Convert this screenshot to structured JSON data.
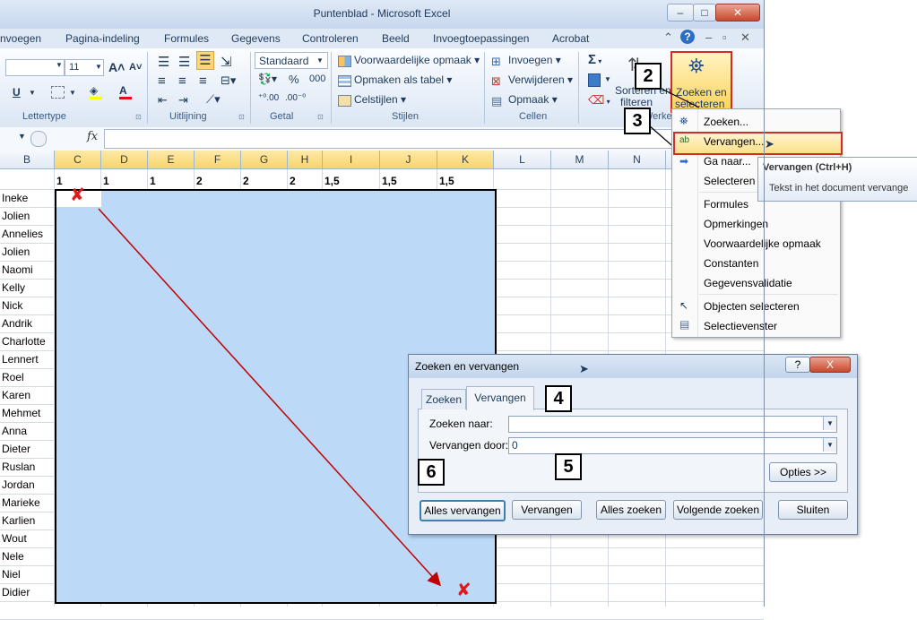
{
  "window": {
    "title": "Puntenblad  -  Microsoft Excel"
  },
  "ribbon_tabs": [
    "nvoegen",
    "Pagina-indeling",
    "Formules",
    "Gegevens",
    "Controleren",
    "Beeld",
    "Invoegtoepassingen",
    "Acrobat"
  ],
  "ribbon": {
    "font_size": "11",
    "number_format": "Standaard",
    "group_labels": {
      "font": "Lettertype",
      "alignment": "Uitlijning",
      "number": "Getal",
      "styles": "Stijlen",
      "cells": "Cellen",
      "editing": "Werke"
    },
    "styles": [
      "Voorwaardelijke opmaak",
      "Opmaken als tabel",
      "Celstijlen"
    ],
    "cells": [
      "Invoegen",
      "Verwijderen",
      "Opmaak"
    ],
    "sort_line1": "Sorteren en",
    "sort_line2": "filteren",
    "find_line1": "Zoeken en",
    "find_line2": "selecteren",
    "sigma": "Σ"
  },
  "formula_bar": {
    "fx": "fx"
  },
  "columns": [
    "B",
    "C",
    "D",
    "E",
    "F",
    "G",
    "H",
    "I",
    "J",
    "K",
    "L",
    "M",
    "N"
  ],
  "header_row": [
    "1",
    "1",
    "1",
    "2",
    "2",
    "2",
    "1,5",
    "1,5",
    "1,5"
  ],
  "rows": [
    "Ineke",
    "Jolien",
    "Annelies",
    "Jolien",
    "Naomi",
    "Kelly",
    "Nick",
    "Andrik",
    "Charlotte",
    "Lennert",
    "Roel",
    "Karen",
    "Mehmet",
    "Anna",
    "Dieter",
    "Ruslan",
    "Jordan",
    "Marieke",
    "Karlien",
    "Wout",
    "Nele",
    "Niel",
    "Didier"
  ],
  "menu": [
    "Zoeken...",
    "Vervangen...",
    "Ga naar...",
    "Selecteren s",
    "Formules",
    "Opmerkingen",
    "Voorwaardelijke opmaak",
    "Constanten",
    "Gegevensvalidatie",
    "Objecten selecteren",
    "Selectievenster"
  ],
  "tooltip": {
    "title": "Vervangen (Ctrl+H)",
    "text": "Tekst in het document vervange"
  },
  "dialog": {
    "title": "Zoeken en vervangen",
    "help": "?",
    "close": "X",
    "tabs": [
      "Zoeken",
      "Vervangen"
    ],
    "find_label": "Zoeken naar:",
    "find_value": "",
    "replace_label": "Vervangen door:",
    "replace_value": "0",
    "options_button": "Opties >>",
    "buttons": [
      "Alles vervangen",
      "Vervangen",
      "Alles zoeken",
      "Volgende zoeken",
      "Sluiten"
    ]
  },
  "callouts": [
    "2",
    "3",
    "4",
    "5",
    "6"
  ],
  "marks": {
    "x": "✘"
  },
  "colors": {
    "selection": "#bcd9f8",
    "highlight": "#d12c2c",
    "arrow": "#c00000",
    "selected_header": "#f8d46c"
  }
}
